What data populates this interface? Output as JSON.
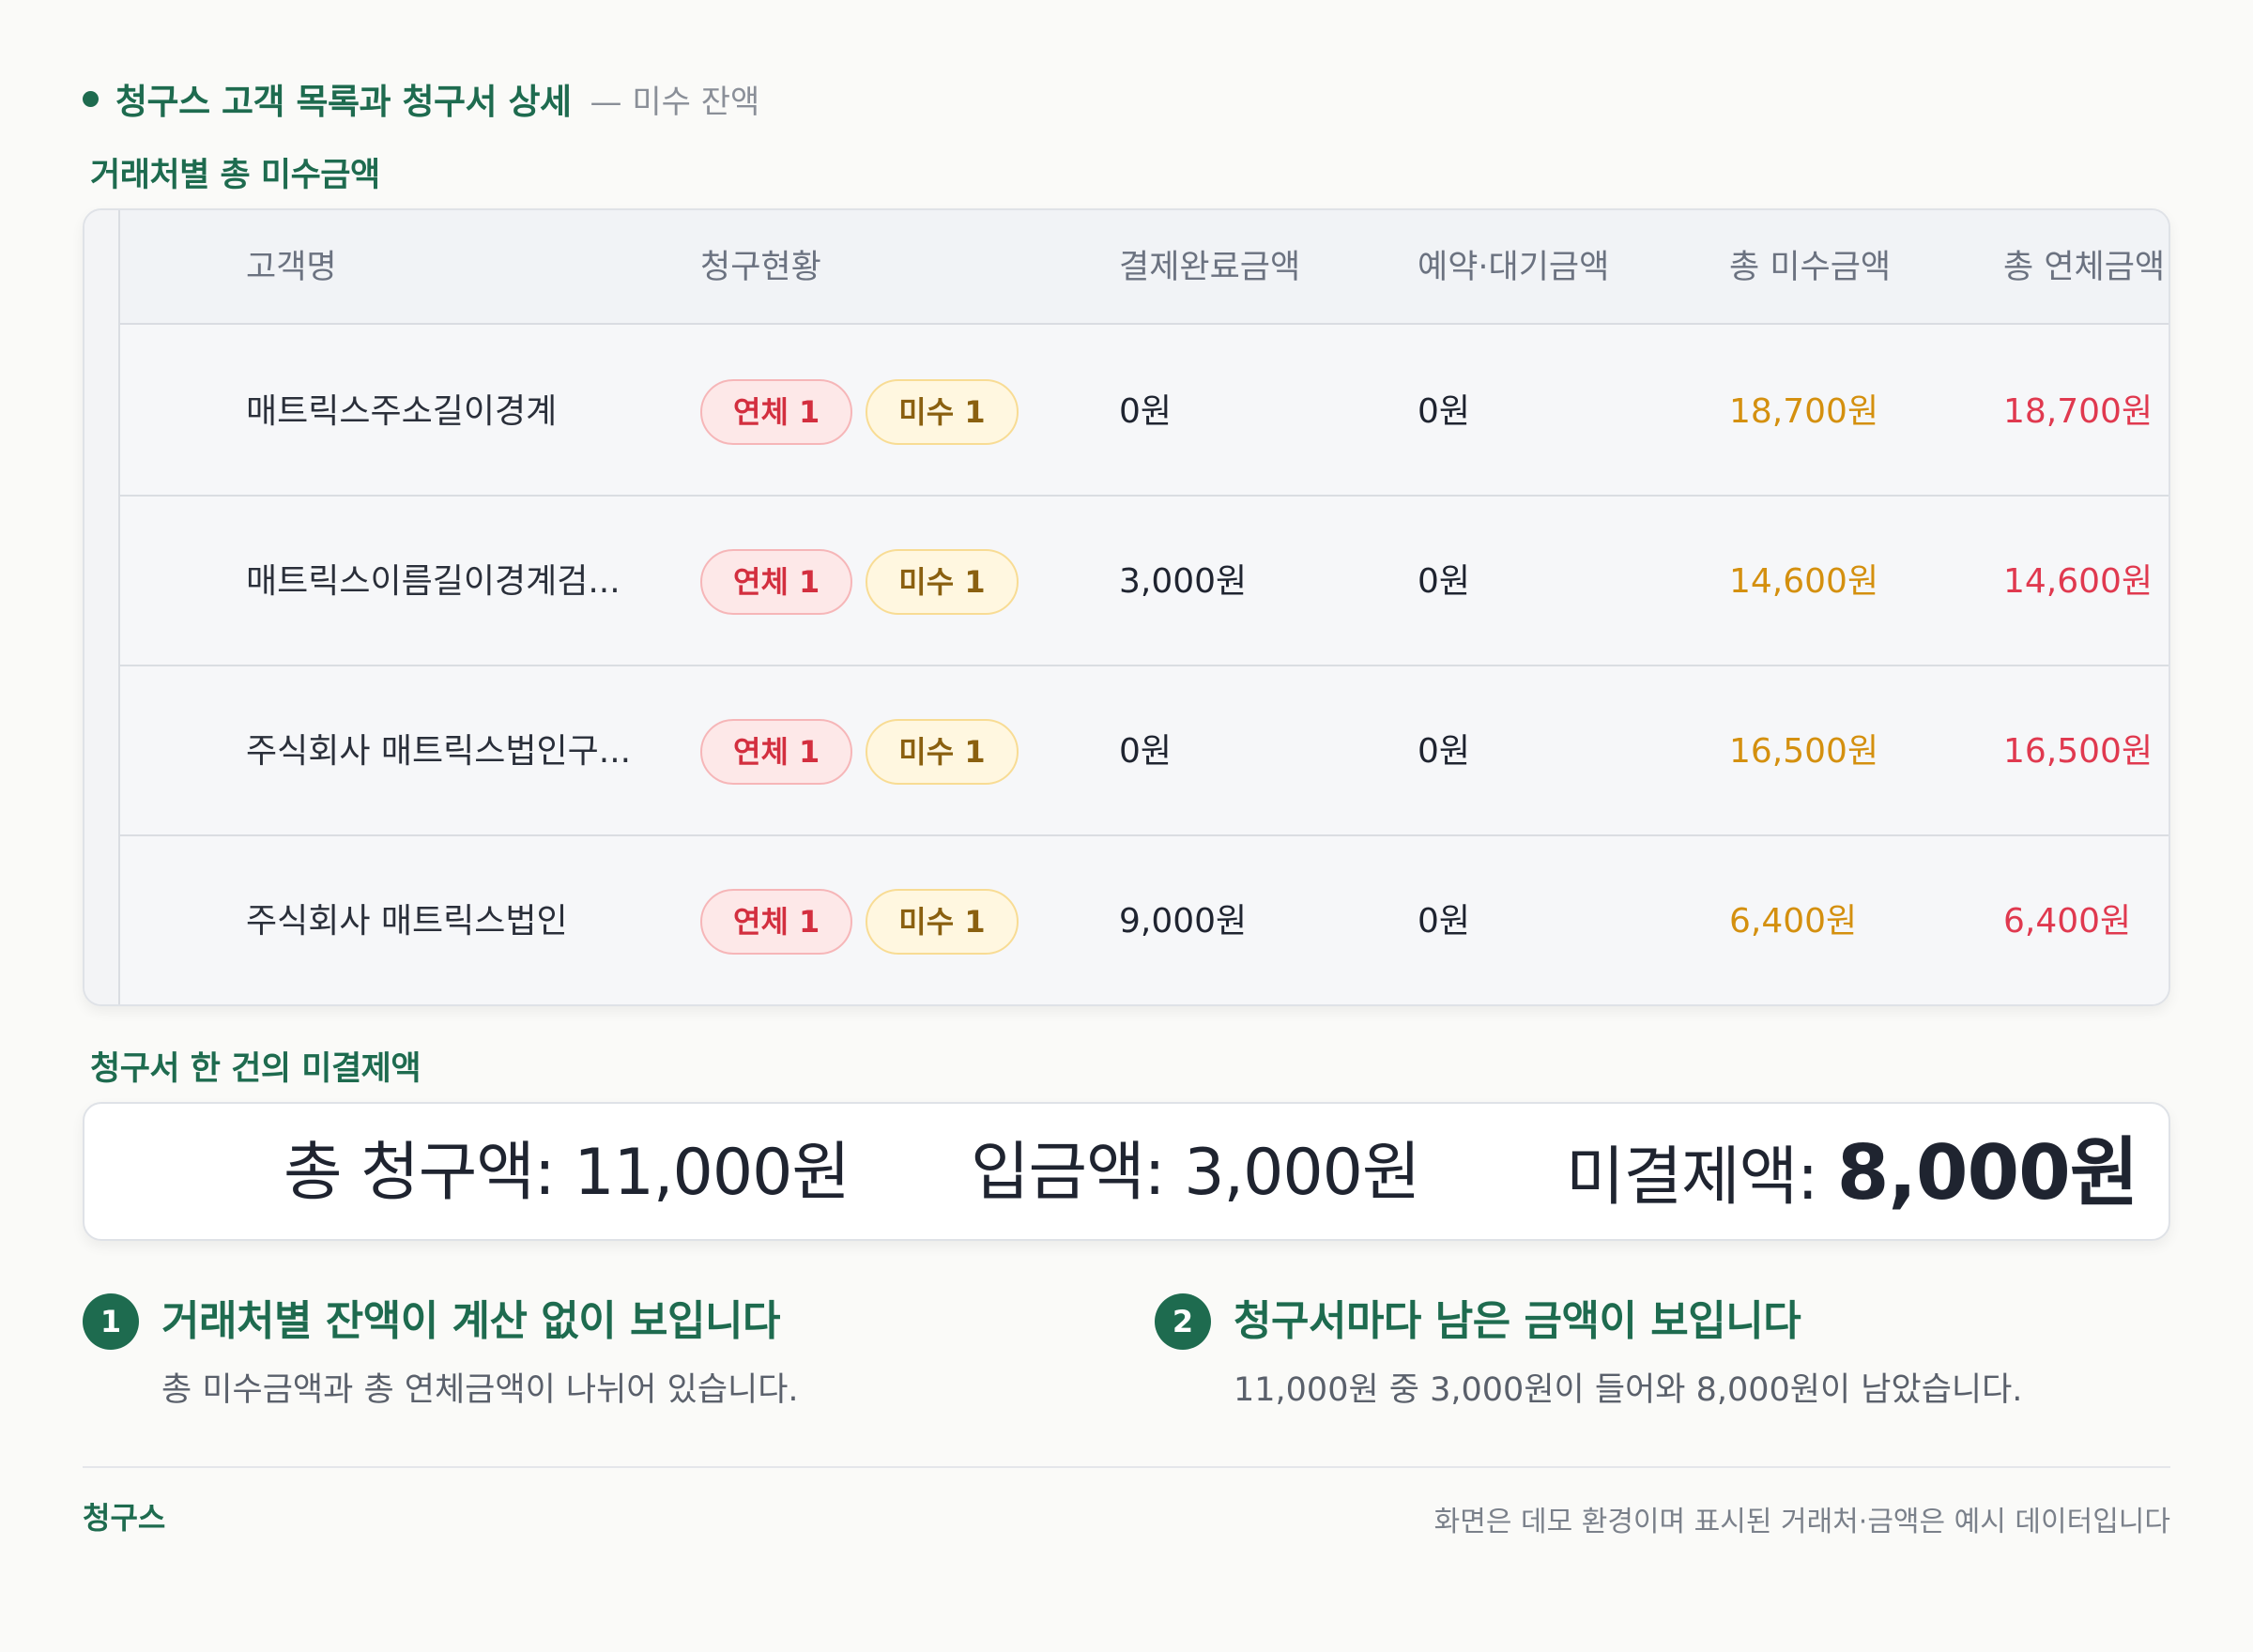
{
  "header": {
    "title": "청구스 고객 목록과 청구서 상세",
    "subtitle": "— 미수 잔액"
  },
  "sections": {
    "table_label": "거래처별 총 미수금액",
    "summary_label": "청구서 한 건의 미결제액"
  },
  "table": {
    "columns": [
      "고객명",
      "청구현황",
      "결제완료금액",
      "예약·대기금액",
      "총 미수금액",
      "총 연체금액"
    ],
    "rows": [
      {
        "name": "매트릭스주소길이경계",
        "overdue_badge": "연체 1",
        "unpaid_badge": "미수 1",
        "paid": "0원",
        "reserved": "0원",
        "total_unpaid": "18,700원",
        "total_overdue": "18,700원"
      },
      {
        "name": "매트릭스이름길이경계검...",
        "overdue_badge": "연체 1",
        "unpaid_badge": "미수 1",
        "paid": "3,000원",
        "reserved": "0원",
        "total_unpaid": "14,600원",
        "total_overdue": "14,600원"
      },
      {
        "name": "주식회사 매트릭스법인구...",
        "overdue_badge": "연체 1",
        "unpaid_badge": "미수 1",
        "paid": "0원",
        "reserved": "0원",
        "total_unpaid": "16,500원",
        "total_overdue": "16,500원"
      },
      {
        "name": "주식회사 매트릭스법인",
        "overdue_badge": "연체 1",
        "unpaid_badge": "미수 1",
        "paid": "9,000원",
        "reserved": "0원",
        "total_unpaid": "6,400원",
        "total_overdue": "6,400원"
      }
    ]
  },
  "summary": {
    "total_label": "총 청구액:",
    "total_value": "11,000원",
    "deposit_label": "입금액:",
    "deposit_value": "3,000원",
    "balance_label": "미결제액:",
    "balance_value": "8,000원"
  },
  "features": [
    {
      "number": "1",
      "title": "거래처별 잔액이 계산 없이 보입니다",
      "desc": "총 미수금액과 총 연체금액이 나뉘어 있습니다."
    },
    {
      "number": "2",
      "title": "청구서마다 남은 금액이 보입니다",
      "desc": "11,000원 중 3,000원이 들어와 8,000원이 남았습니다."
    }
  ],
  "footer": {
    "brand": "청구스",
    "note": "화면은 데모 환경이며 표시된 거래처·금액은 예시 데이터입니다"
  },
  "colors": {
    "brand": "#1e6b4f",
    "unpaid": "#d4900f",
    "overdue": "#e0394f"
  }
}
